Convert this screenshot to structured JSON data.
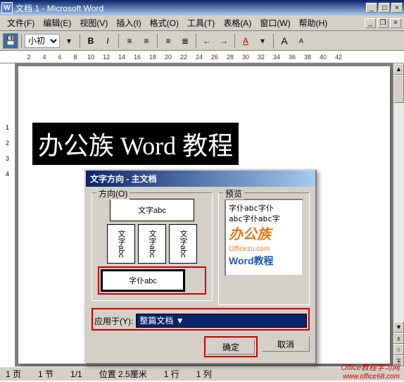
{
  "titlebar": {
    "icon": "W",
    "title": "文档 1 - Microsoft Word"
  },
  "winbtns": {
    "min": "_",
    "max": "□",
    "close": "×"
  },
  "mdi_btns": {
    "min": "_",
    "restore": "❐",
    "close": "×"
  },
  "menu": {
    "file": "文件(F)",
    "edit": "编辑(E)",
    "view": "视图(V)",
    "insert": "插入(I)",
    "format": "格式(O)",
    "tools": "工具(T)",
    "table": "表格(A)",
    "window": "窗口(W)",
    "help": "帮助(H)"
  },
  "toolbar": {
    "save": "💾",
    "fontsize": "小初",
    "bold": "B",
    "italic": "I",
    "align_l": "≡",
    "align_c": "≡",
    "list": "≡",
    "bullets": "≣",
    "indent_l": "←",
    "indent_r": "→",
    "fontcolor": "A",
    "bigA": "A",
    "smallA": "A"
  },
  "ruler": {
    "h": [
      "2",
      "4",
      "6",
      "8",
      "10",
      "12",
      "14",
      "16",
      "18",
      "20",
      "22",
      "24",
      "26",
      "28",
      "30",
      "32",
      "34",
      "36",
      "38",
      "40",
      "42"
    ],
    "v": [
      "1",
      "2",
      "3",
      "4"
    ]
  },
  "document": {
    "selected_text": "办公族 Word 教程"
  },
  "dialog": {
    "title": "文字方向 - 主文档",
    "group_direction": "方向(O)",
    "group_preview": "预览",
    "options": {
      "horiz": "文字abc",
      "vert1": "文字abc",
      "vert2": "文字abc",
      "vert3": "文字abc",
      "sel": "字仆abc"
    },
    "preview": {
      "line1": "字仆abc字仆",
      "line2": "abc字仆abc字",
      "brand": "办公族",
      "brand_sub": "Officezu.com",
      "brand2": "Word教程"
    },
    "apply_label": "应用于(Y):",
    "apply_value": "整篇文档",
    "ok": "确定",
    "cancel": "取消"
  },
  "statusbar": {
    "page": "1 页",
    "section": "1 节",
    "pages": "1/1",
    "pos": "位置 2.5厘米",
    "line": "1 行",
    "col": "1 列"
  },
  "watermark": {
    "line1": "Office教程学习网",
    "line2": "www.office68.com"
  }
}
